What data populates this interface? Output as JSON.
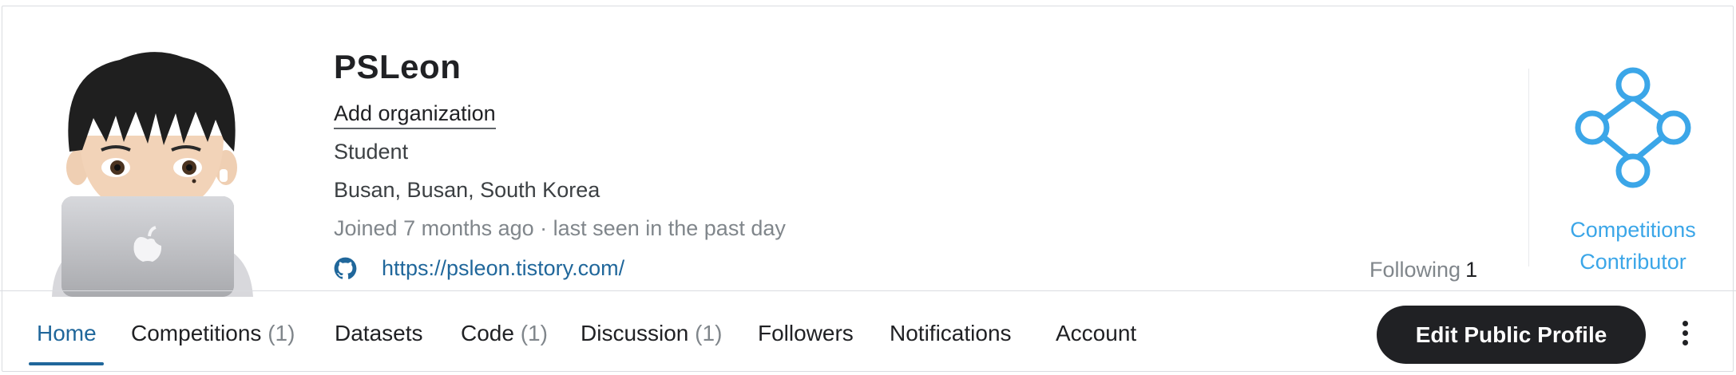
{
  "profile": {
    "username": "PSLeon",
    "add_org_label": "Add organization",
    "occupation": "Student",
    "location": "Busan, Busan, South Korea",
    "joined": "Joined 7 months ago · last seen in the past day",
    "website": "https://psleon.tistory.com/",
    "following_label": "Following",
    "following_count": "1"
  },
  "tier": {
    "line1": "Competitions",
    "line2": "Contributor",
    "color": "#3ba6e8"
  },
  "nav": {
    "tabs": [
      {
        "label": "Home",
        "count": ""
      },
      {
        "label": "Competitions",
        "count": "(1)"
      },
      {
        "label": "Datasets",
        "count": ""
      },
      {
        "label": "Code",
        "count": "(1)"
      },
      {
        "label": "Discussion",
        "count": "(1)"
      },
      {
        "label": "Followers",
        "count": ""
      },
      {
        "label": "Notifications",
        "count": ""
      },
      {
        "label": "Account",
        "count": ""
      }
    ],
    "active": "Home",
    "edit_button": "Edit Public Profile"
  },
  "icons": {
    "github": "github-icon",
    "more": "more-vertical-icon",
    "tier": "competitions-contributor-icon",
    "avatar": "avatar"
  },
  "colors": {
    "accent": "#20679b",
    "tier": "#3ba6e8",
    "button_bg": "#202124"
  }
}
